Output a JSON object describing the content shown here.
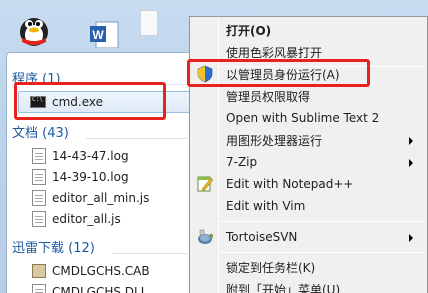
{
  "context_menu": {
    "items": [
      {
        "label": "打开(O)"
      },
      {
        "label": "使用色彩风暴打开"
      },
      {
        "label": "以管理员身份运行(A)"
      },
      {
        "label": "管理员权限取得"
      },
      {
        "label": "Open with Sublime Text 2"
      },
      {
        "label": "用图形处理器运行"
      },
      {
        "label": "7-Zip"
      },
      {
        "label": "Edit with Notepad++"
      },
      {
        "label": "Edit with Vim"
      },
      {
        "label": "TortoiseSVN"
      },
      {
        "label": "锁定到任务栏(K)"
      },
      {
        "label": "附到「开始」菜单(U)"
      }
    ]
  },
  "results": {
    "programs": {
      "title": "程序 (1)",
      "items": [
        {
          "label": "cmd.exe"
        }
      ]
    },
    "documents": {
      "title": "文档 (43)",
      "items": [
        {
          "label": "14-43-47.log"
        },
        {
          "label": "14-39-10.log"
        },
        {
          "label": "editor_all_min.js"
        },
        {
          "label": "editor_all.js"
        }
      ]
    },
    "downloads": {
      "title": "迅雷下载 (12)",
      "items": [
        {
          "label": "CMDLGCHS.CAB"
        },
        {
          "label": "CMDLGCHS.DLL"
        }
      ]
    }
  },
  "highlight_color": "#e8231d",
  "icons": [
    "qq-penguin-icon",
    "word-document-icon",
    "uac-shield-icon",
    "notepad-icon",
    "tortoisesvn-icon",
    "cmd-icon",
    "file-icon",
    "cab-icon",
    "submenu-arrow-icon"
  ]
}
